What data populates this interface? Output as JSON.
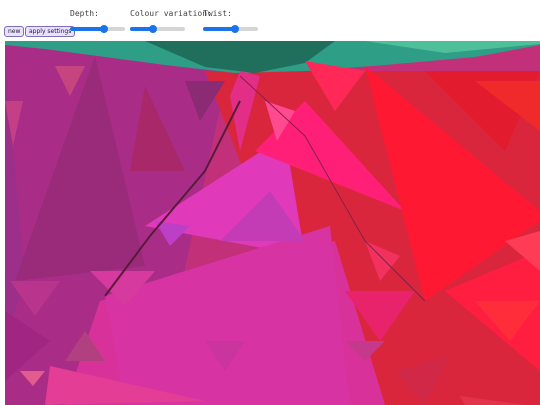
{
  "toolbar": {
    "new_label": "new",
    "apply_label": "apply settings"
  },
  "sliders": {
    "depth": {
      "label": "Depth:",
      "value": 0.62
    },
    "colour_variation": {
      "label": "Colour variation:",
      "value": 0.42
    },
    "twist": {
      "label": "Twist:",
      "value": 0.58
    }
  },
  "colors": {
    "slider_accent": "#1a73e8",
    "button_background": "#e9e1ff",
    "button_border": "#7a70b8"
  }
}
